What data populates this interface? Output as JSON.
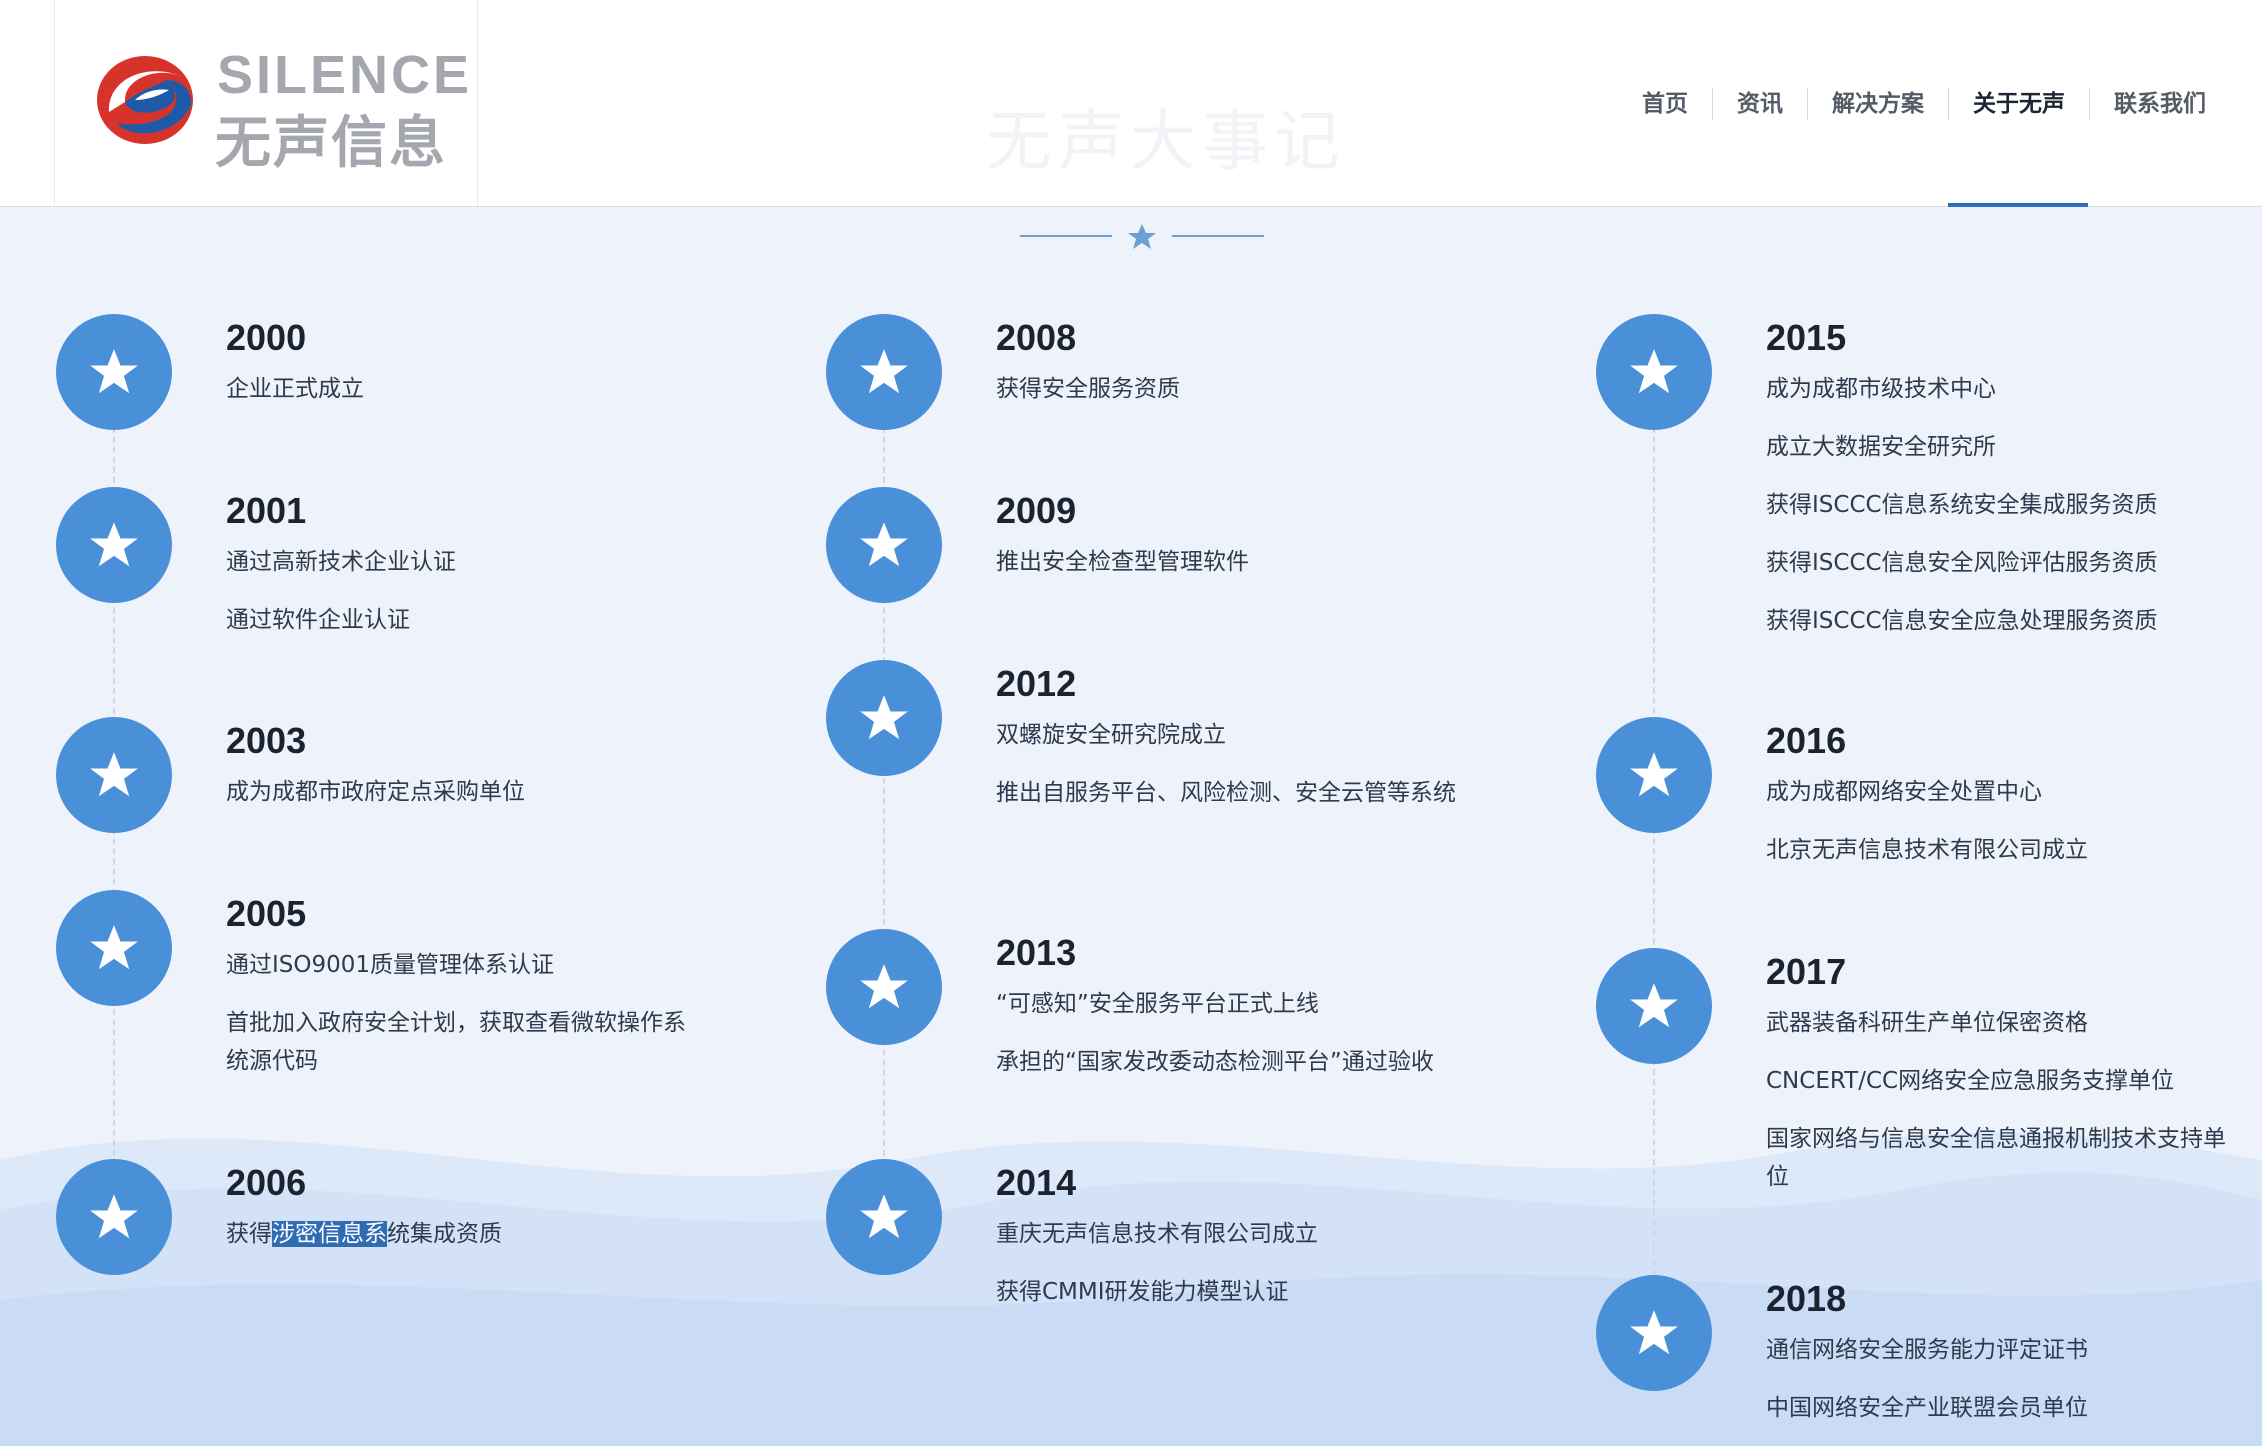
{
  "brand": {
    "logo_en": "SILENCE",
    "logo_cn": "无声信息",
    "logo_icon": "swirl-s-logo-icon",
    "colors": {
      "red": "#d8332a",
      "blue": "#1f5aa8",
      "gray": "#a4a8ae"
    }
  },
  "page_title": "无声大事记",
  "nav": [
    {
      "label": "首页"
    },
    {
      "label": "资讯"
    },
    {
      "label": "解决方案"
    },
    {
      "label": "关于无声",
      "active": true
    },
    {
      "label": "联系我们"
    }
  ],
  "accent": "#4a90d9",
  "nav_accent": "#2f6fb7",
  "timeline": {
    "col1": [
      {
        "year": "2000",
        "items": [
          "企业正式成立"
        ]
      },
      {
        "year": "2001",
        "items": [
          "通过高新技术企业认证",
          "通过软件企业认证"
        ]
      },
      {
        "year": "2003",
        "items": [
          "成为成都市政府定点采购单位"
        ]
      },
      {
        "year": "2005",
        "items": [
          "通过ISO9001质量管理体系认证",
          "首批加入政府安全计划，获取查看微软操作系统源代码"
        ]
      },
      {
        "year": "2006",
        "items_parts": {
          "before": "获得",
          "highlight": "涉密信息系",
          "after": "统集成资质"
        }
      }
    ],
    "col2": [
      {
        "year": "2008",
        "items": [
          "获得安全服务资质"
        ]
      },
      {
        "year": "2009",
        "items": [
          "推出安全检查型管理软件"
        ]
      },
      {
        "year": "2012",
        "items": [
          "双螺旋安全研究院成立",
          "推出自服务平台、风险检测、安全云管等系统"
        ]
      },
      {
        "year": "2013",
        "items": [
          "“可感知”安全服务平台正式上线",
          "承担的“国家发改委动态检测平台”通过验收"
        ]
      },
      {
        "year": "2014",
        "items": [
          "重庆无声信息技术有限公司成立",
          "获得CMMI研发能力模型认证"
        ]
      }
    ],
    "col3": [
      {
        "year": "2015",
        "items": [
          "成为成都市级技术中心",
          "成立大数据安全研究所",
          "获得ISCCC信息系统安全集成服务资质",
          "获得ISCCC信息安全风险评估服务资质",
          "获得ISCCC信息安全应急处理服务资质"
        ]
      },
      {
        "year": "2016",
        "items": [
          "成为成都网络安全处置中心",
          "北京无声信息技术有限公司成立"
        ]
      },
      {
        "year": "2017",
        "items": [
          "武器装备科研生产单位保密资格",
          "CNCERT/CC网络安全应急服务支撑单位",
          "国家网络与信息安全信息通报机制技术支持单位"
        ]
      },
      {
        "year": "2018",
        "items": [
          "通信网络安全服务能力评定证书",
          "中国网络安全产业联盟会员单位"
        ]
      }
    ]
  }
}
